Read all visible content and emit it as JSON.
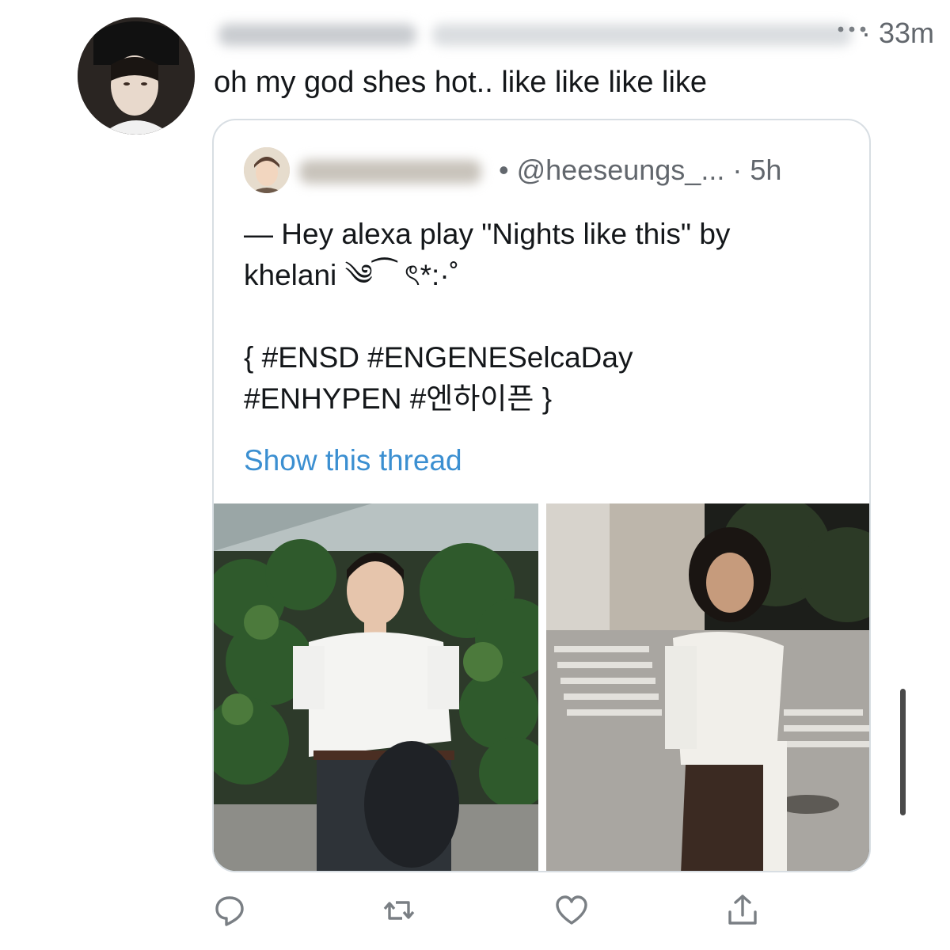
{
  "tweet": {
    "time": "· 33m",
    "text": "oh my god shes hot.. like like like like",
    "more_icon": "more-dots-icon"
  },
  "quoted_tweet": {
    "meta": "• @heeseungs_... · 5h",
    "body_line1": "— Hey alexa play \"Nights like this\" by",
    "body_line2": "khelani ༄⁀ ৎ*:·˚",
    "body_line3": "{ #ENSD #ENGENESelcaDay",
    "body_line4": "#ENHYPEN #엔하이픈 }",
    "show_thread": "Show this thread"
  },
  "actions": [
    {
      "icon": "reply-icon"
    },
    {
      "icon": "retweet-icon"
    },
    {
      "icon": "like-icon"
    },
    {
      "icon": "share-icon"
    }
  ],
  "colors": {
    "link": "#3b8fd1",
    "muted": "#62676d",
    "border": "#d8dee3",
    "text": "#14171a"
  }
}
